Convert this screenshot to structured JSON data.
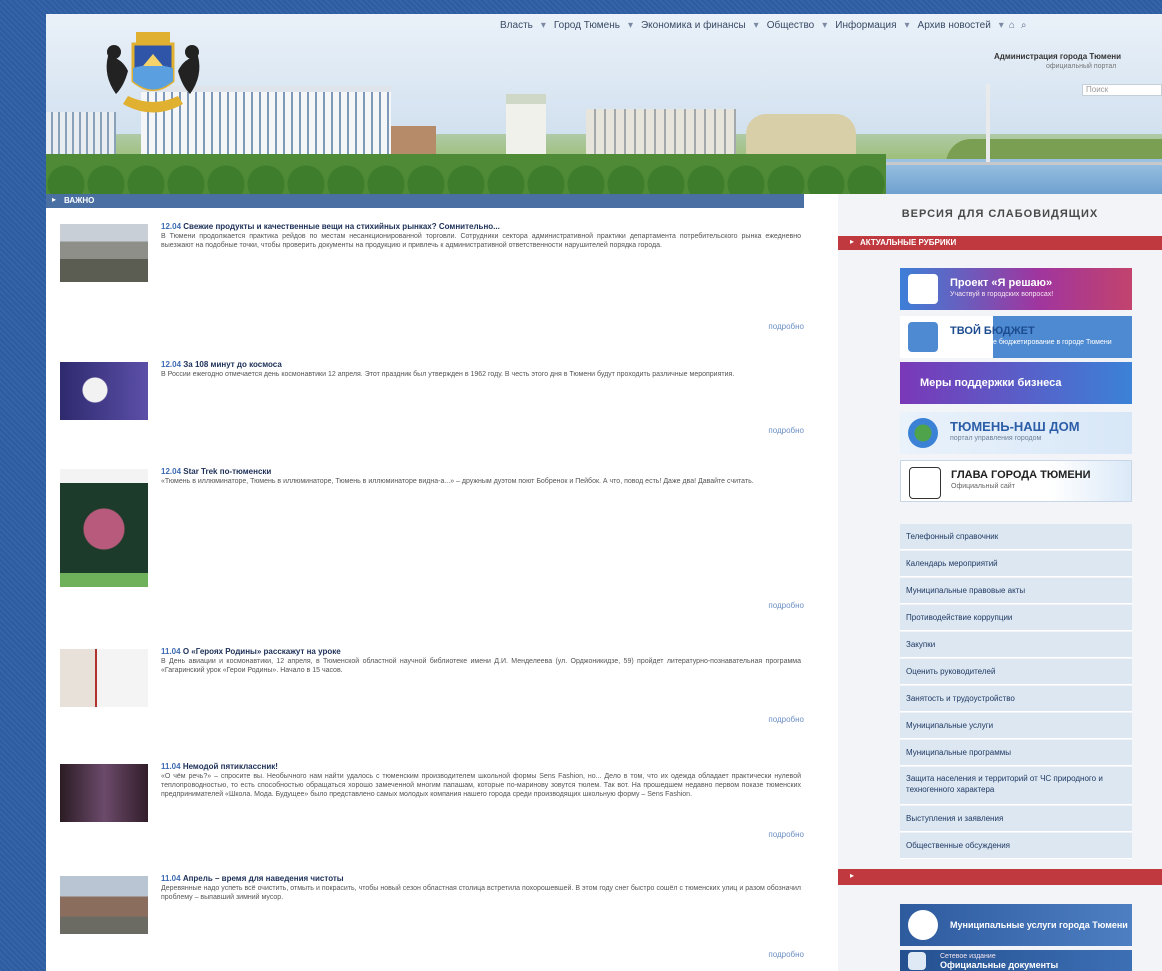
{
  "header": {
    "nav": [
      "Власть",
      "Город Тюмень",
      "Экономика и финансы",
      "Общество",
      "Информация",
      "Архив новостей"
    ],
    "admin_title": "Администрация города Тюмени",
    "admin_subtitle": "официальный портал",
    "search_placeholder": "Поиск"
  },
  "main": {
    "section_label": "ВАЖНО",
    "more_label": "подробно",
    "news": [
      {
        "date": "12.04",
        "title": "Свежие продукты и качественные вещи на стихийных рынках? Сомнительно...",
        "text": "В Тюмени продолжается практика рейдов по местам несанкционированной торговли. Сотрудники сектора административной практики департамента потребительского рынка ежедневно выезжают на подобные точки, чтобы проверить документы на продукцию и привлечь к административной ответственности нарушителей порядка города."
      },
      {
        "date": "12.04",
        "title": "За 108 минут до космоса",
        "text": "В России ежегодно отмечается день космонавтики 12 апреля. Этот праздник был утвержден в 1962 году. В честь этого дня в Тюмени будут проходить различные мероприятия."
      },
      {
        "date": "12.04",
        "title": "Star Trek по-тюменски",
        "text": "«Тюмень в иллюминаторе, Тюмень в иллюминаторе, Тюмень в иллюминаторе видна-а...» – дружным дуэтом поют Бобренок и Пейбок. А что, повод есть! Даже два! Давайте считать."
      },
      {
        "date": "11.04",
        "title": "О «Героях Родины» расскажут на уроке",
        "text": "В День авиации и космонавтики, 12 апреля, в Тюменской областной научной библиотеке имени Д.И. Менделеева (ул. Орджоникидзе, 59) пройдет литературно-познавательная программа «Гагаринский урок «Герои Родины». Начало в 15 часов."
      },
      {
        "date": "11.04",
        "title": "Немодой пятиклассник!",
        "text": "«О чём речь?» – спросите вы. Необычного нам найти удалось с тюменским производителем школьной формы Sens Fashion, но... Дело в том, что их одежда обладает практически нулевой теплопроводностью, то есть способностью обращаться хорошо замеченной многим папашам, которые по-маринову зовутся тюлем. Так вот. На прошедшем недавно первом показе тюменских предпринимателей «Школа. Мода. Будущее» было представлено самых молодых компания нашего города среди производящих школьную форму – Sens Fashion."
      },
      {
        "date": "11.04",
        "title": "Апрель – время для наведения чистоты",
        "text": "Деревянные надо успеть всё очистить, отмыть и покрасить, чтобы новый сезон областная столица встретила похорошевшей. В этом году снег быстро сошёл с тюменских улиц и разом обозначил проблему – выпавший зимний мусор."
      }
    ]
  },
  "sidebar": {
    "vi_title": "ВЕРСИЯ ДЛЯ СЛАБОВИДЯЩИХ",
    "section_label": "АКТУАЛЬНЫЕ РУБРИКИ",
    "banners": [
      {
        "title": "Проект «Я решаю»",
        "subtitle": "Участвуй в городских вопросах!"
      },
      {
        "title": "ТВОЙ БЮДЖЕТ",
        "subtitle": "Инициативное бюджетирование в городе Тюмени"
      },
      {
        "title": "Меры поддержки бизнеса",
        "subtitle": ""
      },
      {
        "title": "ТЮМЕНЬ-НАШ ДОМ",
        "subtitle": "портал управления городом"
      },
      {
        "title": "ГЛАВА ГОРОДА ТЮМЕНИ",
        "subtitle": "Официальный сайт"
      },
      {
        "title": "Муниципальные услуги города Тюмени",
        "subtitle": ""
      },
      {
        "title": "Официальные документы",
        "subtitle": "Сетевое издание"
      }
    ],
    "menu": [
      "Телефонный справочник",
      "Календарь мероприятий",
      "Муниципальные правовые акты",
      "Противодействие коррупции",
      "Закупки",
      "Оценить руководителей",
      "Занятость и трудоустройство",
      "Муниципальные услуги",
      "Муниципальные программы",
      "Защита населения и территорий от ЧС природного и техногенного характера",
      "Выступления и заявления",
      "Общественные обсуждения"
    ]
  },
  "colors": {
    "page_bg": "#2f5fa6",
    "section_blue": "#4a6fa3",
    "accent_red": "#c0393f",
    "menu_bg": "#dde7f2",
    "date_blue": "#3d6bb3"
  }
}
